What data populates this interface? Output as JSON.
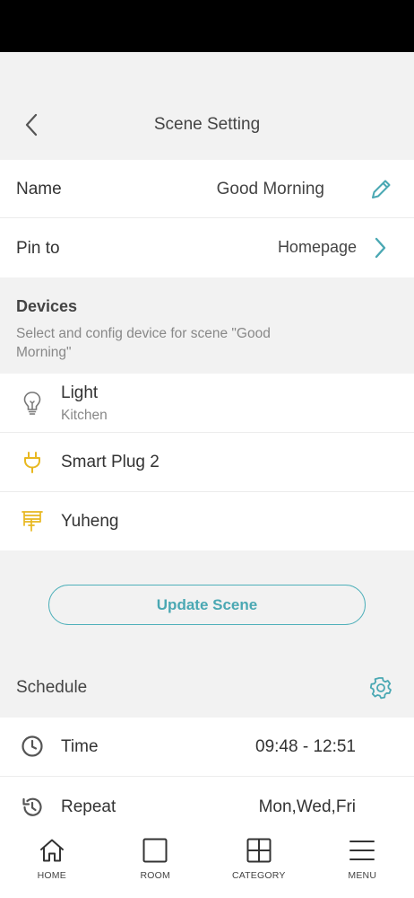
{
  "header": {
    "title": "Scene Setting"
  },
  "name_row": {
    "label": "Name",
    "value": "Good Morning"
  },
  "pin_row": {
    "label": "Pin to",
    "value": "Homepage"
  },
  "devices": {
    "heading": "Devices",
    "subtitle": "Select and config device for scene \"Good Morning\"",
    "items": [
      {
        "name": "Light",
        "room": "Kitchen",
        "icon": "bulb-icon"
      },
      {
        "name": "Smart Plug 2",
        "icon": "plug-icon"
      },
      {
        "name": "Yuheng",
        "icon": "blind-icon"
      }
    ]
  },
  "update_button": {
    "label": "Update Scene"
  },
  "schedule": {
    "label": "Schedule",
    "time_label": "Time",
    "time_value": "09:48 - 12:51",
    "repeat_label": "Repeat",
    "repeat_value": "Mon,Wed,Fri"
  },
  "tabs": [
    {
      "label": "HOME",
      "icon": "home-icon"
    },
    {
      "label": "ROOM",
      "icon": "room-icon"
    },
    {
      "label": "CATEGORY",
      "icon": "category-icon"
    },
    {
      "label": "MENU",
      "icon": "menu-icon"
    }
  ],
  "colors": {
    "accent": "#4aa8b3",
    "device_icon_yellow": "#e8b820",
    "background": "#f2f2f2"
  }
}
